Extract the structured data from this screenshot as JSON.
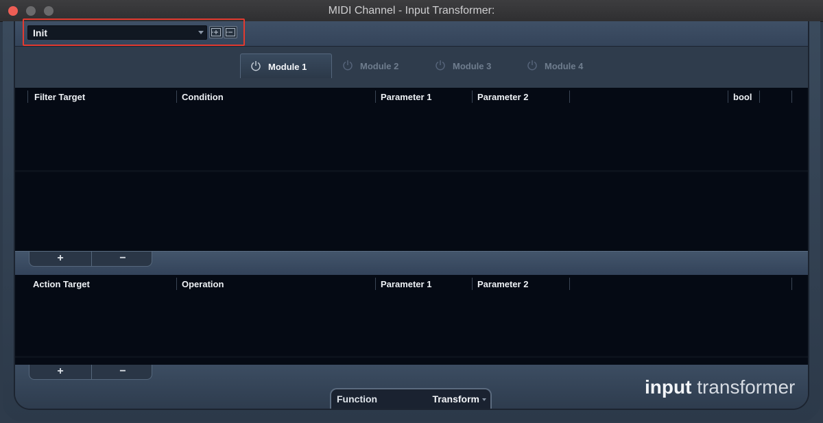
{
  "window": {
    "title": "MIDI Channel - Input Transformer:"
  },
  "preset": {
    "value": "Init"
  },
  "modules": [
    {
      "label": "Module 1",
      "active": true
    },
    {
      "label": "Module 2",
      "active": false
    },
    {
      "label": "Module 3",
      "active": false
    },
    {
      "label": "Module 4",
      "active": false
    }
  ],
  "filter_table": {
    "headers": [
      "Filter Target",
      "Condition",
      "Parameter 1",
      "Parameter 2",
      "bool"
    ]
  },
  "action_table": {
    "headers": [
      "Action Target",
      "Operation",
      "Parameter 1",
      "Parameter 2"
    ]
  },
  "controls": {
    "add_label": "+",
    "remove_label": "−"
  },
  "function": {
    "label": "Function",
    "value": "Transform"
  },
  "brand": {
    "bold": "input",
    "light": "transformer"
  },
  "colors": {
    "highlight": "#e43a2f",
    "close": "#ee5e55"
  }
}
